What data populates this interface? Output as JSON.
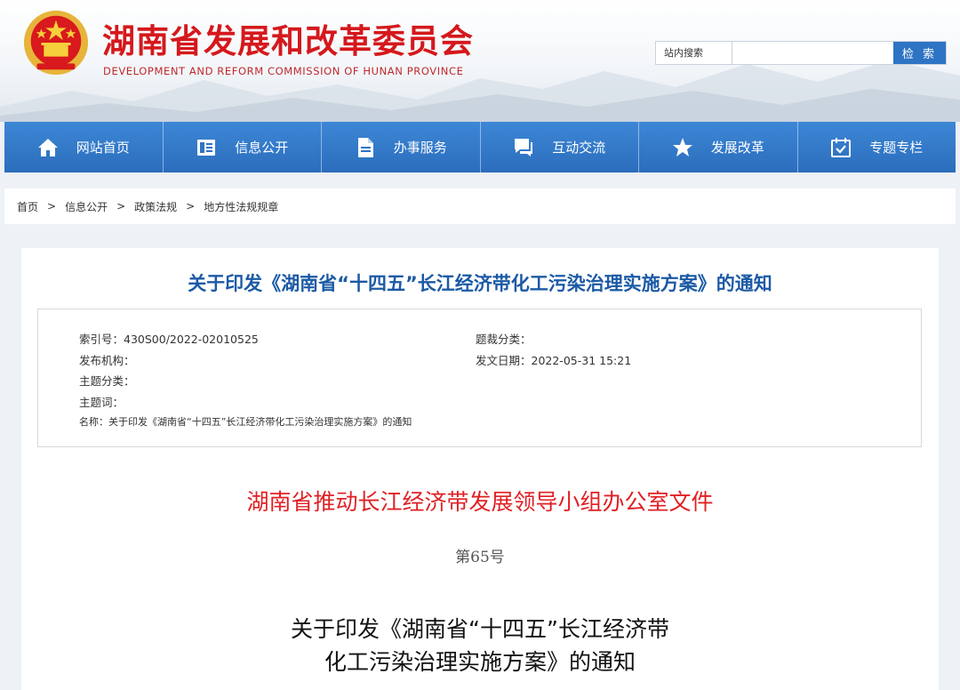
{
  "header": {
    "title": "湖南省发展和改革委员会",
    "subtitle": "DEVELOPMENT AND REFORM COMMISSION OF HUNAN PROVINCE",
    "emblem_icon": "national-emblem-icon",
    "search": {
      "label": "站内搜索",
      "placeholder": "",
      "value": "",
      "button": "检 索"
    }
  },
  "nav": [
    {
      "label": "网站首页",
      "icon": "home-icon"
    },
    {
      "label": "信息公开",
      "icon": "document-list-icon"
    },
    {
      "label": "办事服务",
      "icon": "file-icon"
    },
    {
      "label": "互动交流",
      "icon": "chat-icon"
    },
    {
      "label": "发展改革",
      "icon": "star-icon"
    },
    {
      "label": "专题专栏",
      "icon": "calendar-check-icon"
    }
  ],
  "breadcrumb": {
    "items": [
      "首页",
      "信息公开",
      "政策法规",
      "地方性法规规章"
    ],
    "separator": ">"
  },
  "article": {
    "title": "关于印发《湖南省“十四五”长江经济带化工污染治理实施方案》的通知",
    "meta": {
      "index_no": "索引号：430S00/2022-02010525",
      "genre": "题裁分类：",
      "publisher": "发布机构：",
      "date": "发文日期：2022-05-31 15:21",
      "topic": "主题分类：",
      "keywords": "主题词：",
      "name": "名称：关于印发《湖南省“十四五”长江经济带化工污染治理实施方案》的通知"
    },
    "doc_org": "湖南省推动长江经济带发展领导小组办公室文件",
    "doc_number": "第65号",
    "doc_title_line1": "关于印发《湖南省“十四五”长江经济带",
    "doc_title_line2": "化工污染治理实施方案》的通知"
  },
  "colors": {
    "brand_red": "#d5181c",
    "nav_blue": "#2e74c4",
    "title_blue": "#1b5aa5",
    "doc_red": "#e02024"
  }
}
